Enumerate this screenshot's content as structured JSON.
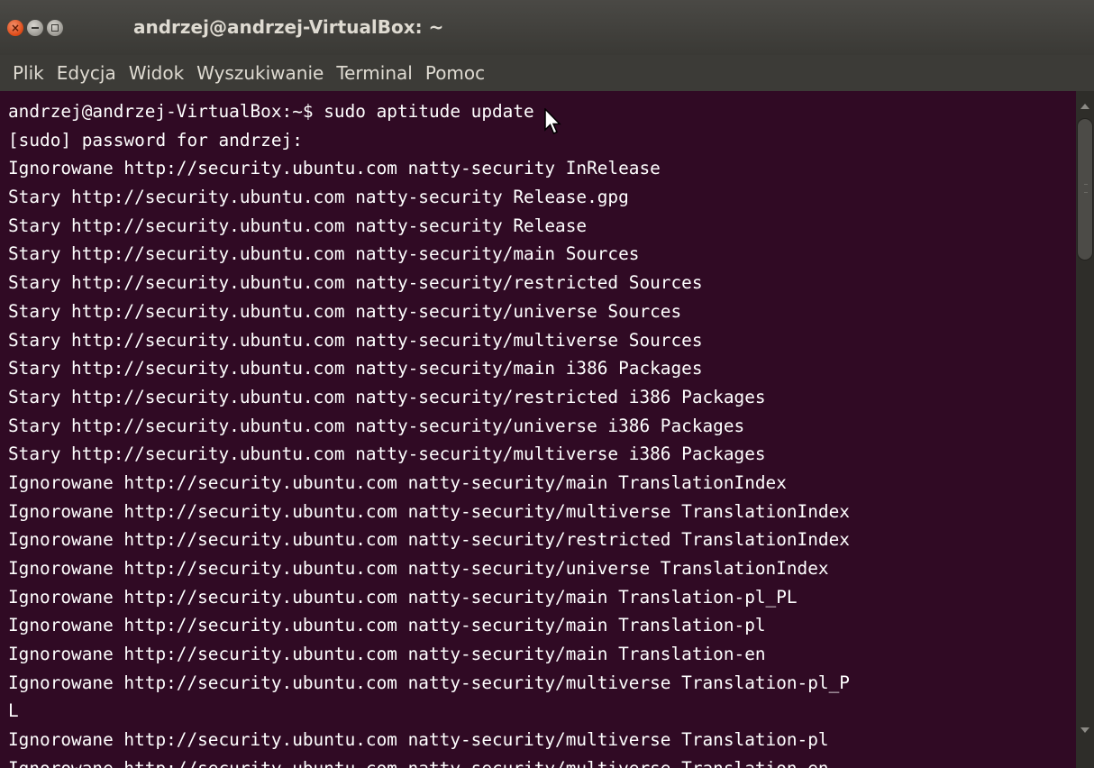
{
  "window": {
    "title": "andrzej@andrzej-VirtualBox: ~",
    "controls": [
      "close-icon",
      "minimize-icon",
      "maximize-icon"
    ]
  },
  "menu": [
    "Plik",
    "Edycja",
    "Widok",
    "Wyszukiwanie",
    "Terminal",
    "Pomoc"
  ],
  "terminal": {
    "background": "#300a24",
    "foreground": "#ffffff",
    "lines": [
      "andrzej@andrzej-VirtualBox:~$ sudo aptitude update",
      "[sudo] password for andrzej:",
      "Ignorowane http://security.ubuntu.com natty-security InRelease",
      "Stary http://security.ubuntu.com natty-security Release.gpg",
      "Stary http://security.ubuntu.com natty-security Release",
      "Stary http://security.ubuntu.com natty-security/main Sources",
      "Stary http://security.ubuntu.com natty-security/restricted Sources",
      "Stary http://security.ubuntu.com natty-security/universe Sources",
      "Stary http://security.ubuntu.com natty-security/multiverse Sources",
      "Stary http://security.ubuntu.com natty-security/main i386 Packages",
      "Stary http://security.ubuntu.com natty-security/restricted i386 Packages",
      "Stary http://security.ubuntu.com natty-security/universe i386 Packages",
      "Stary http://security.ubuntu.com natty-security/multiverse i386 Packages",
      "Ignorowane http://security.ubuntu.com natty-security/main TranslationIndex",
      "Ignorowane http://security.ubuntu.com natty-security/multiverse TranslationIndex",
      "Ignorowane http://security.ubuntu.com natty-security/restricted TranslationIndex",
      "Ignorowane http://security.ubuntu.com natty-security/universe TranslationIndex",
      "Ignorowane http://security.ubuntu.com natty-security/main Translation-pl_PL",
      "Ignorowane http://security.ubuntu.com natty-security/main Translation-pl",
      "Ignorowane http://security.ubuntu.com natty-security/main Translation-en",
      "Ignorowane http://security.ubuntu.com natty-security/multiverse Translation-pl_P",
      "L",
      "Ignorowane http://security.ubuntu.com natty-security/multiverse Translation-pl",
      "Ignorowane http://security.ubuntu.com natty-security/multiverse Translation-en"
    ]
  },
  "colors": {
    "titlebar": "#3c3b37",
    "close_button": "#dd4814",
    "terminal_bg": "#300a24"
  }
}
